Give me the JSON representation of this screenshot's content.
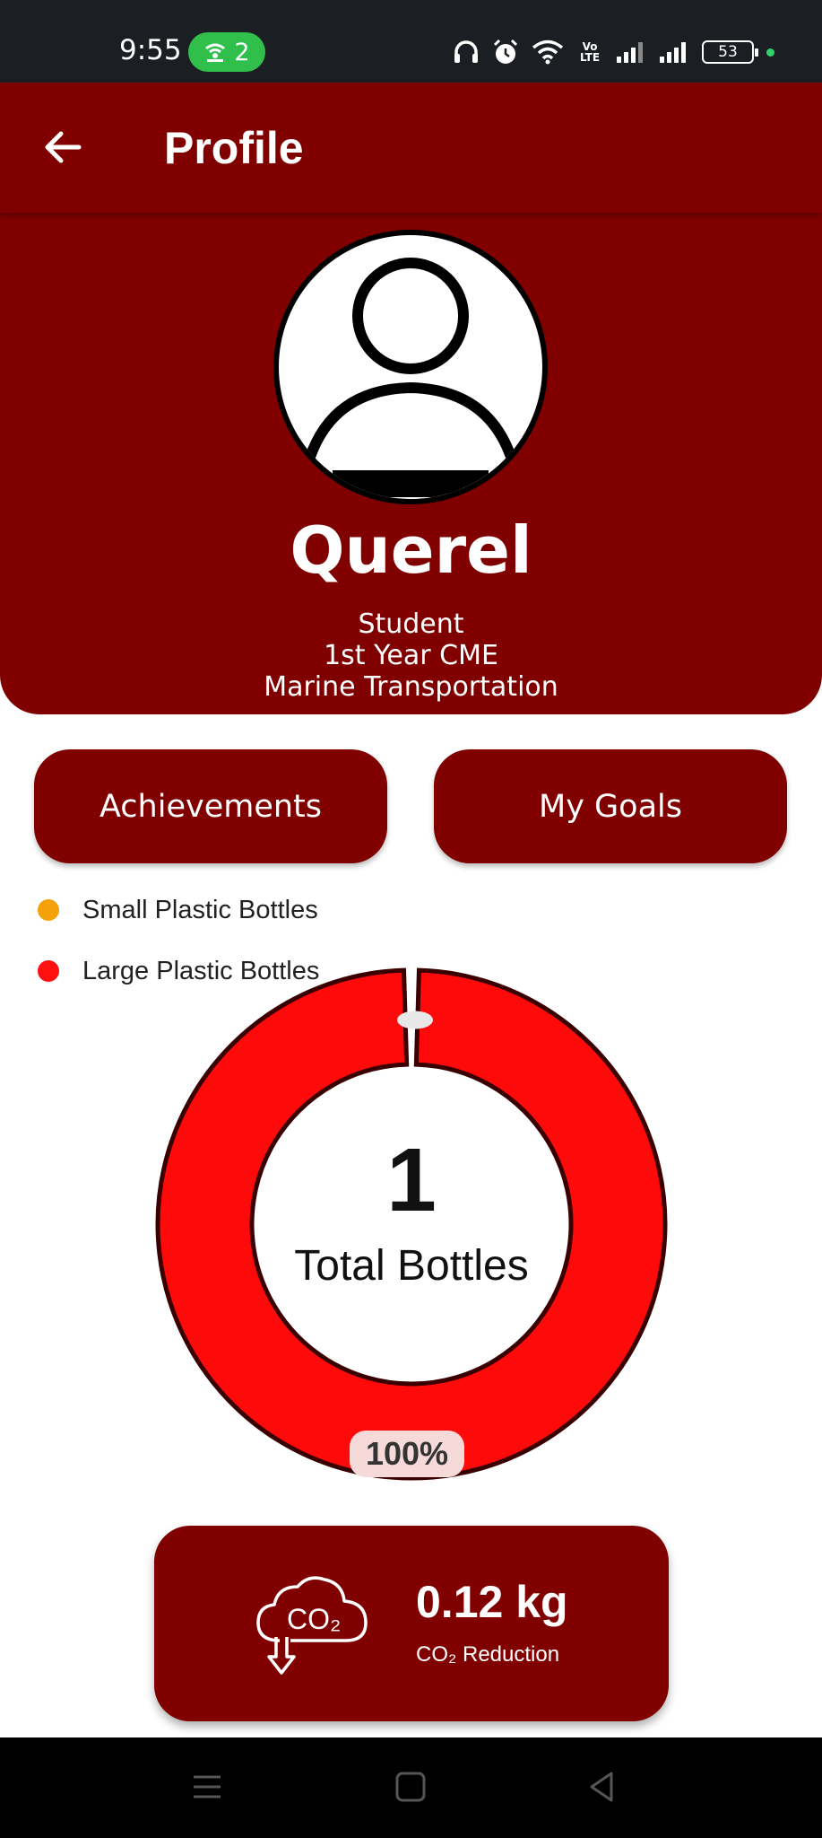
{
  "status_bar": {
    "time": "9:55",
    "hotspot_count": "2",
    "volte": "Vo LTE",
    "battery": "53",
    "icons": [
      "headphones-icon",
      "alarm-icon",
      "wifi-icon",
      "volte-icon",
      "signal-icon",
      "signal-icon",
      "battery-icon"
    ]
  },
  "header": {
    "title": "Profile",
    "back_icon": "arrow-left-icon"
  },
  "profile": {
    "name": "Querel",
    "role_line1": "Student",
    "role_line2": "1st Year CME",
    "role_line3": "Marine Transportation",
    "avatar_icon": "user-avatar-icon"
  },
  "buttons": {
    "achievements": "Achievements",
    "goals": "My Goals"
  },
  "legend": [
    {
      "label": "Small Plastic Bottles",
      "color": "#f5a20a"
    },
    {
      "label": "Large Plastic Bottles",
      "color": "#ff1010"
    }
  ],
  "chart_data": {
    "type": "pie",
    "donut": true,
    "series": [
      {
        "name": "Small Plastic Bottles",
        "value": 0,
        "color": "#f5a20a"
      },
      {
        "name": "Large Plastic Bottles",
        "value": 1,
        "color": "#ff0a0a"
      }
    ],
    "center_value": "1",
    "center_label": "Total Bottles",
    "percent_label": "100%"
  },
  "co2": {
    "value": "0.12 kg",
    "label": "CO₂ Reduction",
    "icon": "co2-cloud-icon",
    "icon_text": "CO₂"
  },
  "nav": {
    "icons": [
      "menu-icon",
      "home-square-icon",
      "back-triangle-icon"
    ]
  },
  "colors": {
    "primary": "#800000",
    "white": "#ffffff"
  }
}
